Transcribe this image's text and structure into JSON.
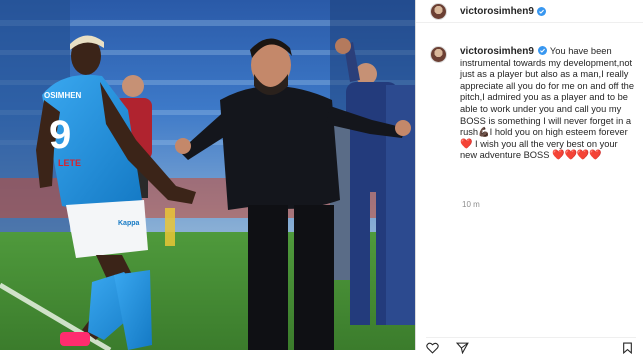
{
  "post": {
    "username": "victorosimhen9",
    "verified": true,
    "caption": {
      "part1": "You have been instrumental towards my development,not just as a player but also as a man,I really appreciate all you do for me on and off the pitch,I admired you as a player and to be able to work under you and call you my BOSS is something I will never forget in a rush",
      "emoji1": "💪🏿",
      "part2": "I hold you on high esteem forever",
      "emoji2": "❤️",
      "part3": " I wish you all the very best on your new adventure BOSS",
      "emoji3": "❤️❤️❤️❤️"
    },
    "time": "10 m"
  },
  "photo": {
    "player_number": "9",
    "player_name_on_shirt": "OSIMHEN",
    "sponsor": "LETE",
    "brand": "Kappa"
  },
  "icons": {
    "verified": "verified-badge-icon",
    "like": "heart-icon",
    "share": "send-icon",
    "save": "bookmark-icon"
  },
  "colors": {
    "napoli_blue": "#1e8fd9",
    "verified_blue": "#3897f0",
    "heart_red": "#ed1c3a"
  }
}
